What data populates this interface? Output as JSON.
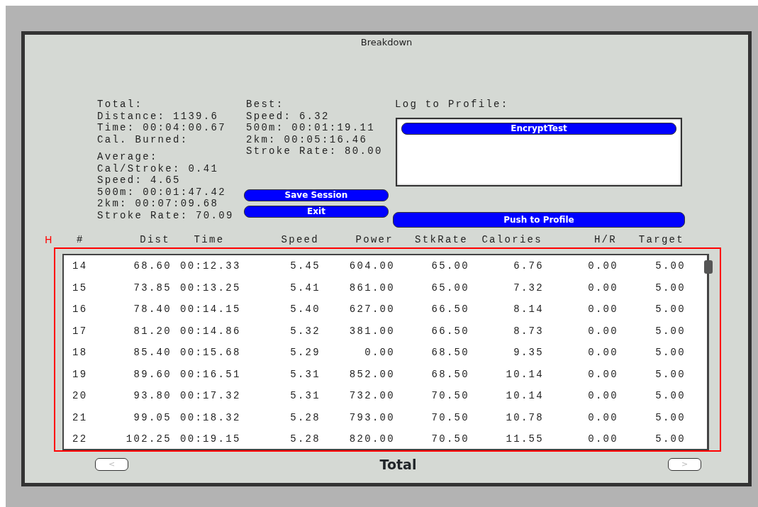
{
  "window": {
    "title": "Breakdown"
  },
  "total": {
    "heading": "Total:",
    "lines": [
      "Distance: 1139.6",
      "Time: 00:04:00.67",
      "Cal. Burned:"
    ]
  },
  "average": {
    "heading": "Average:",
    "lines": [
      "Cal/Stroke: 0.41",
      "Speed: 4.65",
      "500m: 00:01:47.42",
      "2km: 00:07:09.68",
      "Stroke Rate: 70.09"
    ]
  },
  "best": {
    "heading": "Best:",
    "lines": [
      "Speed: 6.32",
      "500m: 00:01:19.11",
      "2km: 00:05:16.46",
      "Stroke Rate: 80.00"
    ]
  },
  "buttons": [
    "Save Session",
    "Exit"
  ],
  "log_to_profile": {
    "label": "Log to Profile:",
    "profiles": [
      {
        "name": "EncryptTest",
        "selected": true
      }
    ],
    "button": "Push to Profile"
  },
  "annotation": {
    "label": "H"
  },
  "table": {
    "columns": [
      "#",
      "Dist",
      "Time",
      "Speed",
      "Power",
      "StkRate",
      "Calories",
      "H/R",
      "Target"
    ],
    "rows": [
      [
        "14",
        "68.60",
        "00:12.33",
        "5.45",
        "604.00",
        "65.00",
        "6.76",
        "0.00",
        "5.00"
      ],
      [
        "15",
        "73.85",
        "00:13.25",
        "5.41",
        "861.00",
        "65.00",
        "7.32",
        "0.00",
        "5.00"
      ],
      [
        "16",
        "78.40",
        "00:14.15",
        "5.40",
        "627.00",
        "66.50",
        "8.14",
        "0.00",
        "5.00"
      ],
      [
        "17",
        "81.20",
        "00:14.86",
        "5.32",
        "381.00",
        "66.50",
        "8.73",
        "0.00",
        "5.00"
      ],
      [
        "18",
        "85.40",
        "00:15.68",
        "5.29",
        "0.00",
        "68.50",
        "9.35",
        "0.00",
        "5.00"
      ],
      [
        "19",
        "89.60",
        "00:16.51",
        "5.31",
        "852.00",
        "68.50",
        "10.14",
        "0.00",
        "5.00"
      ],
      [
        "20",
        "93.80",
        "00:17.32",
        "5.31",
        "732.00",
        "70.50",
        "10.14",
        "0.00",
        "5.00"
      ],
      [
        "21",
        "99.05",
        "00:18.32",
        "5.28",
        "793.00",
        "70.50",
        "10.78",
        "0.00",
        "5.00"
      ],
      [
        "22",
        "102.25",
        "00:19.15",
        "5.28",
        "820.00",
        "70.50",
        "11.55",
        "0.00",
        "5.00"
      ]
    ]
  },
  "footer": {
    "prev": "<",
    "title": "Total",
    "next": ">"
  }
}
